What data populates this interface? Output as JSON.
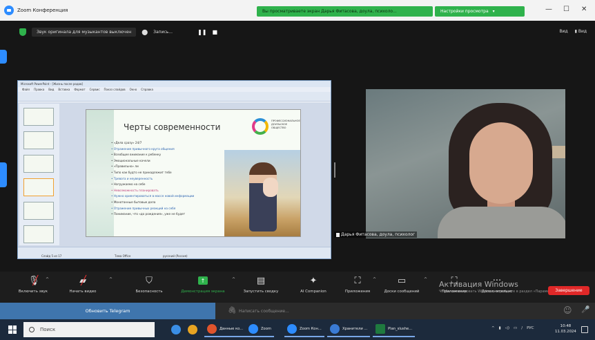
{
  "window": {
    "title": "Zoom Конференция",
    "share_banner": "Вы просматриваете экран Дарья Фитасова, доула, психоло...",
    "view_options": "Настройки просмотра",
    "min": "—",
    "max": "☐",
    "close": "✕"
  },
  "meeting": {
    "audio_message": "Звук оригинала для музыкантов выключен",
    "recording_label": "Запись...",
    "view_label": "Вид",
    "view_label2": "Вид"
  },
  "presentation": {
    "window_title": "Microsoft PowerPoint - [Жизнь после родов]",
    "menu": [
      "Файл",
      "Правка",
      "Вид",
      "Вставка",
      "Формат",
      "Сервис",
      "Показ слайдов",
      "Окно",
      "Справка"
    ],
    "slide_title": "Черты современности",
    "bullets": [
      "«Дела сразу» 24/7",
      "Отражение привычного круга общения",
      "Всеобщее внимание к ребенку",
      "Эмоциональные качели",
      "«Правильно» ли",
      "Типо как будто не принадлежит тебе",
      "Тревога и неуверенность",
      "Нагружаемо на себе",
      "Невозможность планировать",
      "Нужно ориентироваться в массе новой информации",
      "Монотонные бытовые дела",
      "Отражение привычных реакций на себя",
      "Понимание, что «до рождения», уже не будет"
    ],
    "logo_text": "ПРОФЕССИОНАЛЬНОЕ ДОУЛЬСКОЕ ОБЩЕСТВО",
    "status_slide": "Слайд 5 из 17",
    "status_theme": "Тема Office",
    "status_lang": "русский (Россия)"
  },
  "video": {
    "participant_name": "Дарья Фитасова, доула, психолог"
  },
  "toolbar": {
    "items": [
      {
        "label": "Включить звук",
        "icon": "mic-muted-icon"
      },
      {
        "label": "Начать видео",
        "icon": "video-off-icon"
      },
      {
        "label": "Безопасность",
        "icon": "shield-icon"
      },
      {
        "label": "Демонстрация экрана",
        "icon": "share-screen-icon"
      },
      {
        "label": "Запустить сводку",
        "icon": "summary-icon"
      },
      {
        "label": "AI Companion",
        "icon": "sparkle-icon"
      },
      {
        "label": "Приложения",
        "icon": "apps-icon"
      },
      {
        "label": "Доски сообщений",
        "icon": "whiteboard-icon"
      },
      {
        "label": "Приложения",
        "icon": "apps-icon"
      },
      {
        "label": "Дополнительно",
        "icon": "more-icon"
      }
    ],
    "end_label": "Завершение",
    "activation_title": "Активация Windows",
    "activation_sub": "Чтобы активировать Windows, перейдите в раздел «Параметры»."
  },
  "telegram": {
    "update_label": "Обновить Telegram",
    "message_placeholder": "Написать сообщение..."
  },
  "taskbar": {
    "search_placeholder": "Поиск",
    "apps": [
      {
        "label": "Данные ко...",
        "color": "#e0542c"
      },
      {
        "label": "Zoom",
        "color": "#2d8cff"
      },
      {
        "label": "Zoom Кон...",
        "color": "#2d8cff"
      },
      {
        "label": "Хранители ...",
        "color": "#3a7bd5"
      },
      {
        "label": "Plan_slushe...",
        "color": "#1f7a3f"
      }
    ],
    "lang": "РУС",
    "time": "10:48",
    "date": "11.03.2024"
  }
}
